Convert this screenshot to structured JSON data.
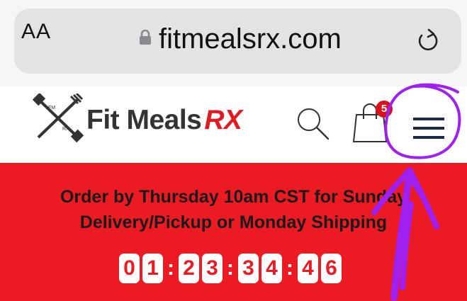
{
  "browser": {
    "text_size_label": "AA",
    "url": "fitmealsrx.com",
    "lock_icon": "lock-icon",
    "reload_icon": "reload-icon"
  },
  "site": {
    "brand_main": "Fit Meals",
    "brand_accent": "RX",
    "brand_accent_color": "#e11b22",
    "search_icon": "search-icon",
    "cart_icon": "shopping-bag-icon",
    "cart_count": "5",
    "menu_icon": "hamburger-menu-icon"
  },
  "banner": {
    "background": "#ec1b23",
    "line1": "Order by Thursday 10am CST for Sunday",
    "line2": "Delivery/Pickup or Monday Shipping",
    "countdown": {
      "d1": "0",
      "d2": "1",
      "h1": "2",
      "h2": "3",
      "m1": "3",
      "m2": "4",
      "s1": "4",
      "s2": "6",
      "separator": ":"
    }
  },
  "annotations": {
    "color": "#a020f0",
    "circle": "hand-drawn circle around menu icon",
    "arrow": "hand-drawn arrow pointing to menu icon"
  }
}
